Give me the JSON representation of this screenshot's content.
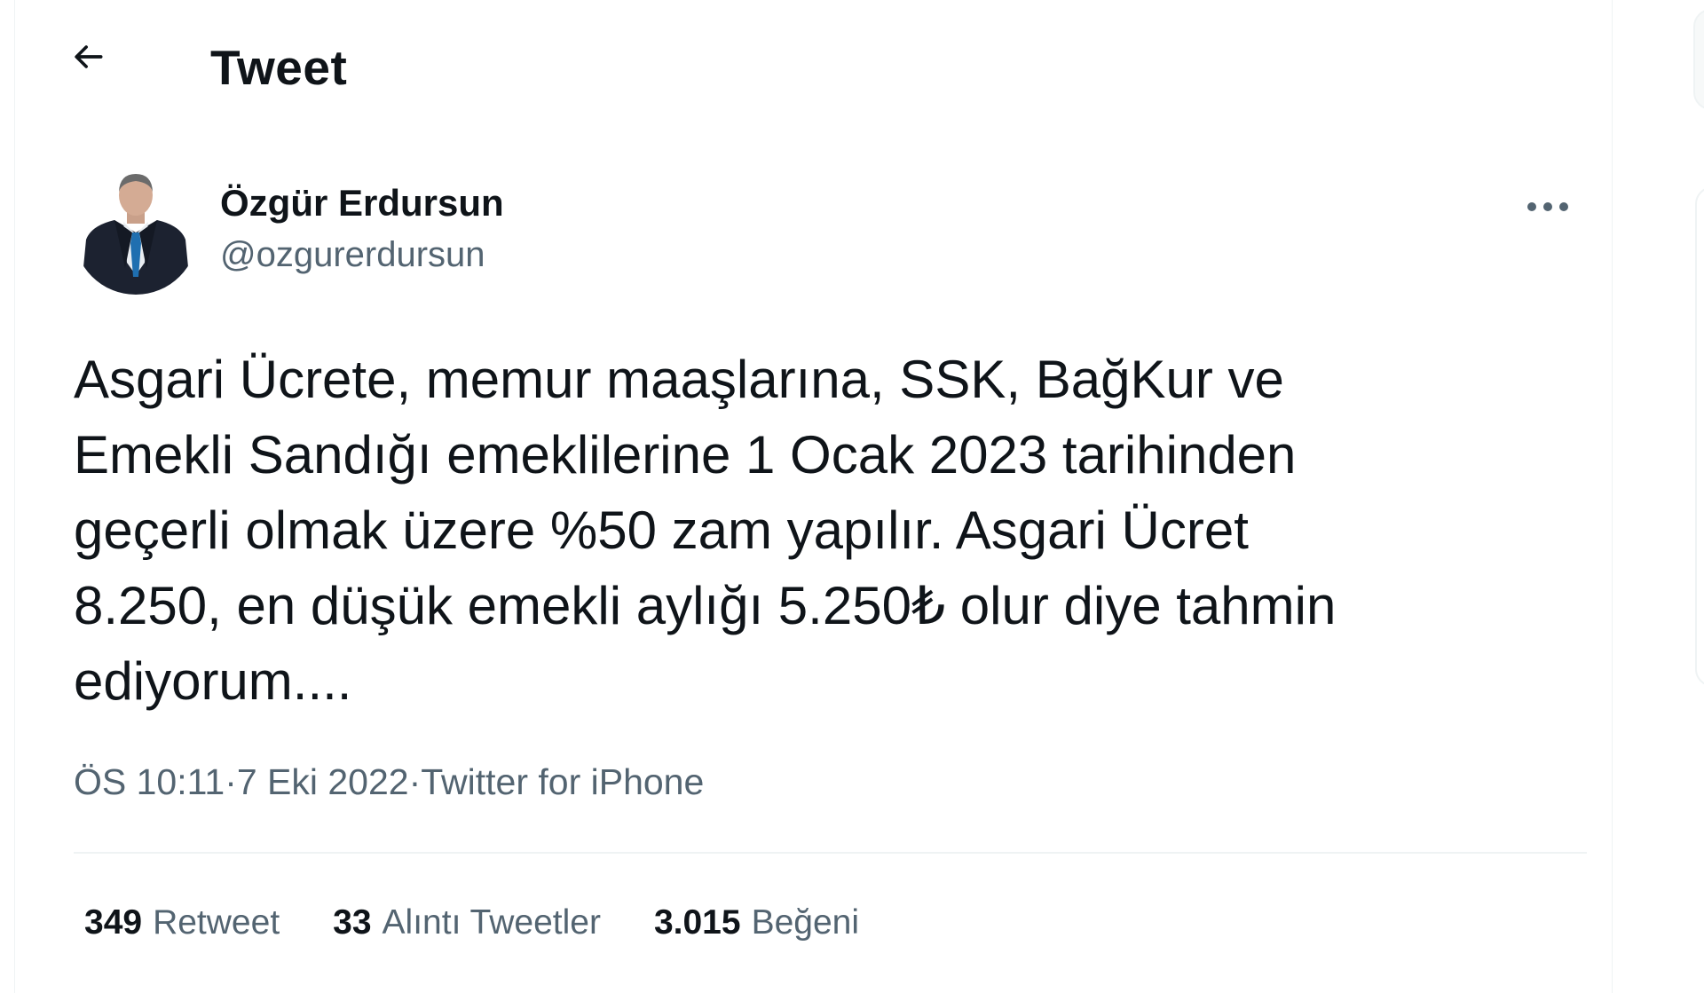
{
  "header": {
    "title": "Tweet",
    "back_icon": "arrow-left-icon"
  },
  "author": {
    "name": "Özgür Erdursun",
    "handle": "@ozgurerdursun",
    "more_icon": "more-horizontal-icon"
  },
  "tweet": {
    "text": "Asgari Ücrete, memur maaşlarına, SSK, BağKur ve\nEmekli Sandığı emeklilerine 1 Ocak 2023 tarihinden\ngeçerli olmak üzere %50 zam yapılır. Asgari Ücret\n8.250, en düşük emekli aylığı 5.250₺ olur diye tahmin\nediyorum...."
  },
  "meta": {
    "time": "ÖS 10:11",
    "separator": " · ",
    "date": "7 Eki 2022",
    "source": "Twitter for iPhone"
  },
  "stats": [
    {
      "count": "349",
      "label": "Retweet"
    },
    {
      "count": "33",
      "label": "Alıntı Tweetler"
    },
    {
      "count": "3.015",
      "label": "Beğeni"
    }
  ],
  "colors": {
    "text": "#0f1419",
    "secondary": "#536471",
    "border": "#eff3f4"
  }
}
